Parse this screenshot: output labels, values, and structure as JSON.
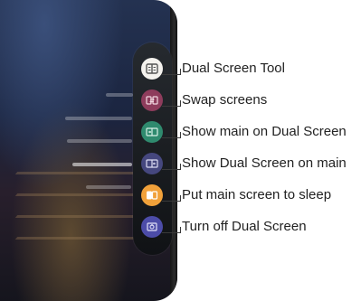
{
  "callouts": [
    {
      "label": "Dual Screen Tool",
      "icon": "dual-screen-tool-icon",
      "color": "#f4f2ee"
    },
    {
      "label": "Swap screens",
      "icon": "swap-screens-icon",
      "color": "#8e3c5c"
    },
    {
      "label": "Show main on Dual Screen",
      "icon": "show-main-on-dual-icon",
      "color": "#2f8a6e"
    },
    {
      "label": "Show Dual Screen on main",
      "icon": "show-dual-on-main-icon",
      "color": "#45477e"
    },
    {
      "label": "Put main screen to sleep",
      "icon": "sleep-main-screen-icon",
      "color": "#f1a13a"
    },
    {
      "label": "Turn off Dual Screen",
      "icon": "turn-off-dual-icon",
      "color": "#4c4ca8"
    }
  ]
}
